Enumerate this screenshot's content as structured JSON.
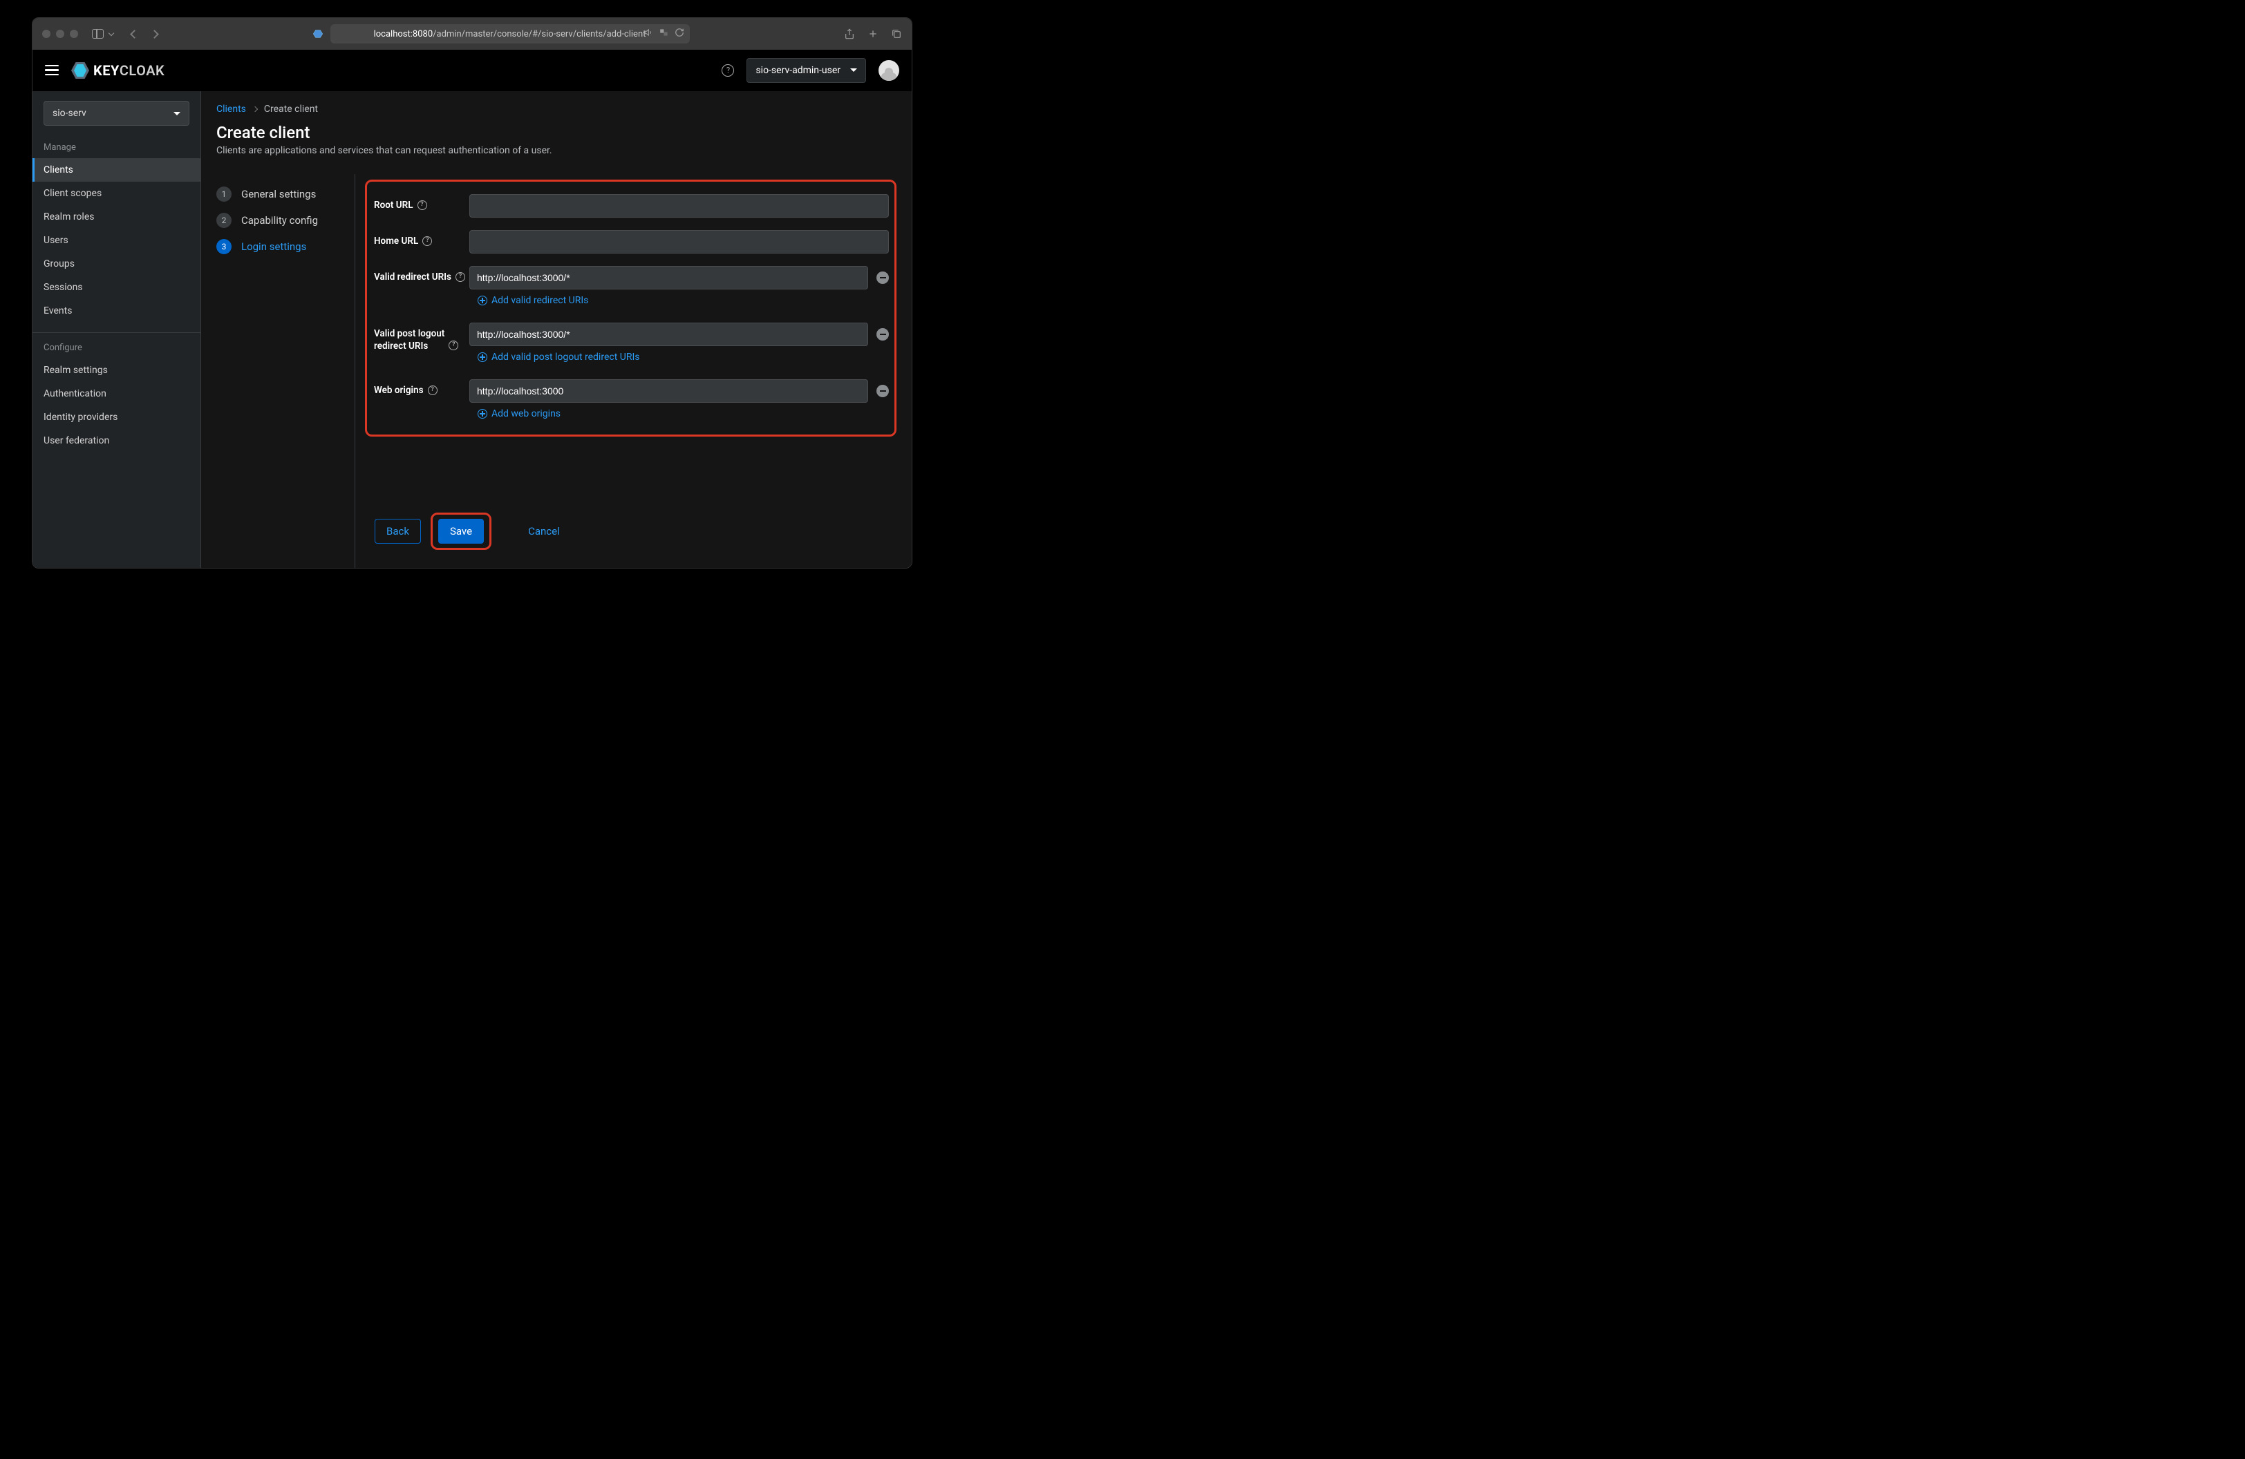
{
  "browser": {
    "url_host": "localhost:8080",
    "url_path": "/admin/master/console/#/sio-serv/clients/add-client"
  },
  "header": {
    "brand_a": "KEY",
    "brand_b": "CLOAK",
    "user_realm": "sio-serv-admin-user"
  },
  "sidebar": {
    "realm": "sio-serv",
    "section_manage": "Manage",
    "section_configure": "Configure",
    "manage_items": [
      {
        "label": "Clients",
        "active": true
      },
      {
        "label": "Client scopes"
      },
      {
        "label": "Realm roles"
      },
      {
        "label": "Users"
      },
      {
        "label": "Groups"
      },
      {
        "label": "Sessions"
      },
      {
        "label": "Events"
      }
    ],
    "configure_items": [
      {
        "label": "Realm settings"
      },
      {
        "label": "Authentication"
      },
      {
        "label": "Identity providers"
      },
      {
        "label": "User federation"
      }
    ]
  },
  "breadcrumb": {
    "link": "Clients",
    "current": "Create client"
  },
  "page": {
    "title": "Create client",
    "desc": "Clients are applications and services that can request authentication of a user."
  },
  "wizard": {
    "steps": [
      {
        "n": "1",
        "label": "General settings"
      },
      {
        "n": "2",
        "label": "Capability config"
      },
      {
        "n": "3",
        "label": "Login settings",
        "active": true
      }
    ]
  },
  "form": {
    "root_url": {
      "label": "Root URL",
      "value": ""
    },
    "home_url": {
      "label": "Home URL",
      "value": ""
    },
    "redirect": {
      "label": "Valid redirect URIs",
      "value": "http://localhost:3000/*",
      "add": "Add valid redirect URIs"
    },
    "post_logout": {
      "label_l1": "Valid post logout",
      "label_l2": "redirect URIs",
      "value": "http://localhost:3000/*",
      "add": "Add valid post logout redirect URIs"
    },
    "web_origins": {
      "label": "Web origins",
      "value": "http://localhost:3000",
      "add": "Add web origins"
    }
  },
  "actions": {
    "back": "Back",
    "save": "Save",
    "cancel": "Cancel"
  }
}
